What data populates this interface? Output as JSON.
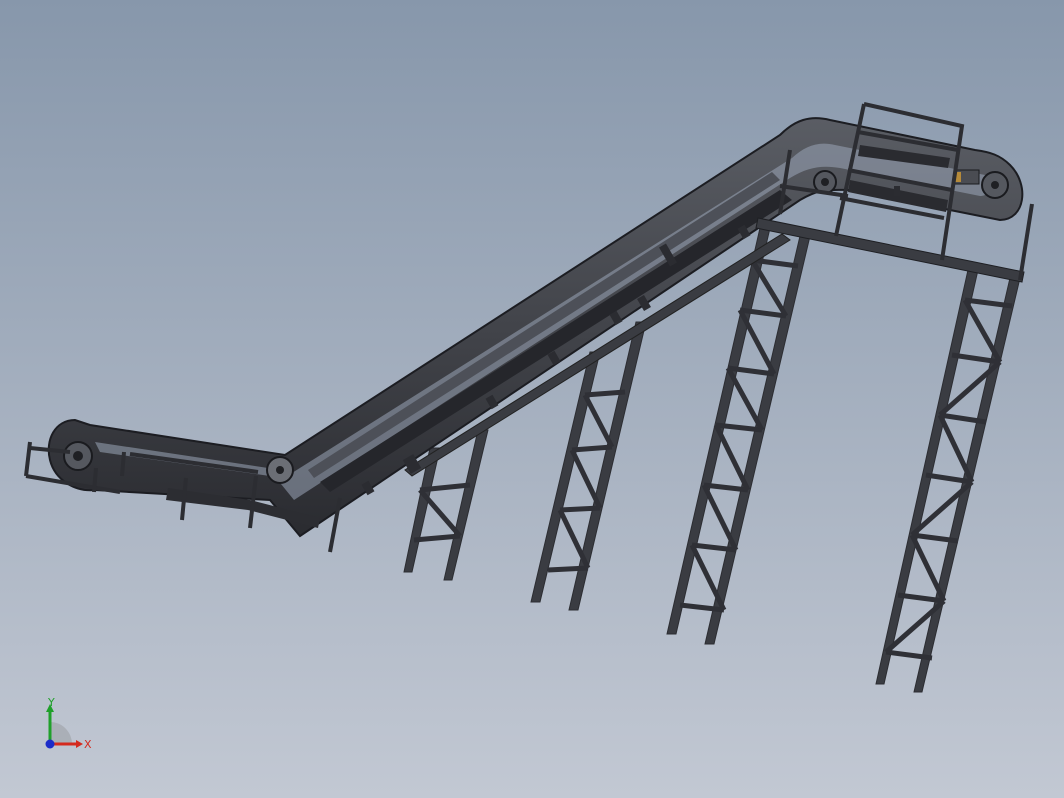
{
  "viewport": {
    "background_top": "#8797ab",
    "background_bottom": "#c2c8d3"
  },
  "model": {
    "steel_color": "#3c3e44",
    "steel_dark": "#1f2024",
    "roller_color": "#55585f",
    "motor_color": "#b58a3a"
  },
  "triad": {
    "x_label": "X",
    "y_label": "Y",
    "x_color": "#d42a1e",
    "y_color": "#1fa02a",
    "z_color": "#1c2cc9"
  }
}
